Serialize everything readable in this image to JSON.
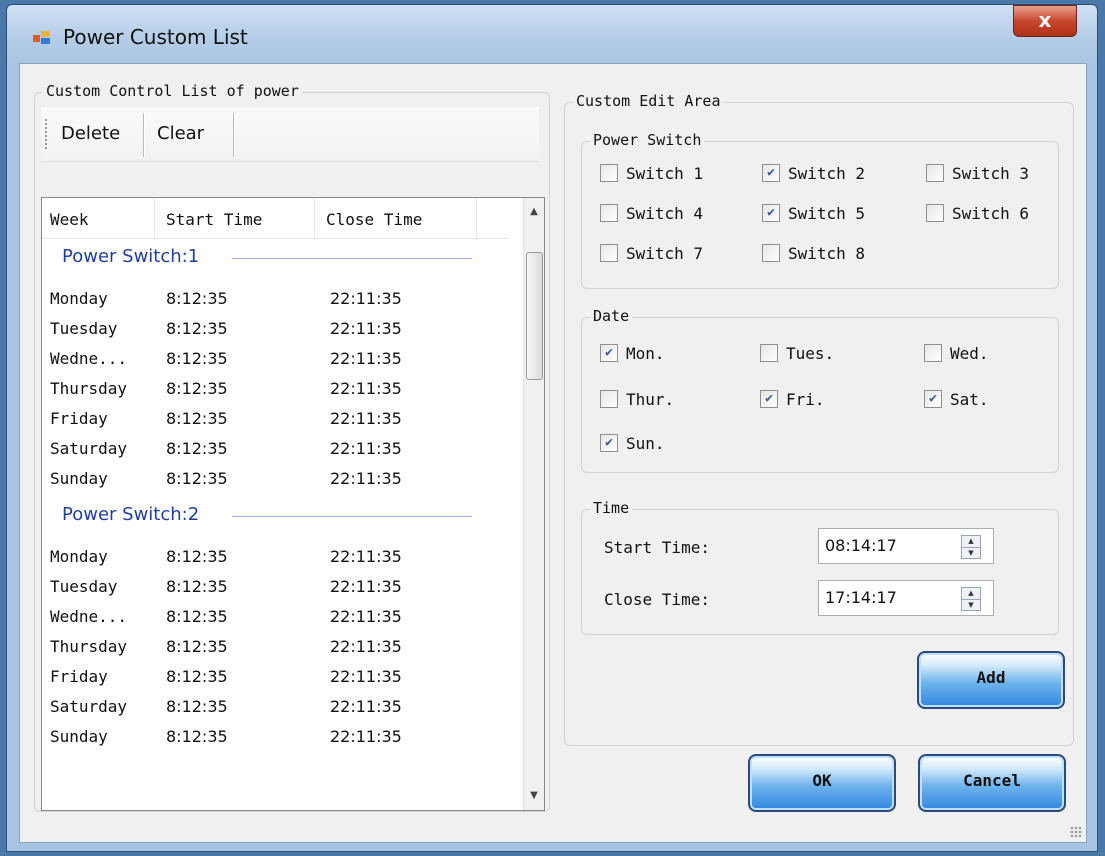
{
  "window": {
    "title": "Power Custom List",
    "close_glyph": "x"
  },
  "left_panel": {
    "legend": "Custom Control List of power",
    "toolbar": {
      "delete_label": "Delete",
      "clear_label": "Clear"
    },
    "columns": [
      "Week",
      "Start Time",
      "Close Time"
    ],
    "groups": [
      {
        "title": "Power Switch:1",
        "rows": [
          [
            "Monday",
            "8:12:35",
            "22:11:35"
          ],
          [
            "Tuesday",
            "8:12:35",
            "22:11:35"
          ],
          [
            "Wedne...",
            "8:12:35",
            "22:11:35"
          ],
          [
            "Thursday",
            "8:12:35",
            "22:11:35"
          ],
          [
            "Friday",
            "8:12:35",
            "22:11:35"
          ],
          [
            "Saturday",
            "8:12:35",
            "22:11:35"
          ],
          [
            "Sunday",
            "8:12:35",
            "22:11:35"
          ]
        ]
      },
      {
        "title": "Power Switch:2",
        "rows": [
          [
            "Monday",
            "8:12:35",
            "22:11:35"
          ],
          [
            "Tuesday",
            "8:12:35",
            "22:11:35"
          ],
          [
            "Wedne...",
            "8:12:35",
            "22:11:35"
          ],
          [
            "Thursday",
            "8:12:35",
            "22:11:35"
          ],
          [
            "Friday",
            "8:12:35",
            "22:11:35"
          ],
          [
            "Saturday",
            "8:12:35",
            "22:11:35"
          ],
          [
            "Sunday",
            "8:12:35",
            "22:11:35"
          ]
        ]
      }
    ]
  },
  "edit_area": {
    "legend": "Custom Edit Area",
    "power_switch": {
      "legend": "Power Switch",
      "items": [
        {
          "label": "Switch 1",
          "checked": false
        },
        {
          "label": "Switch 2",
          "checked": true
        },
        {
          "label": "Switch 3",
          "checked": false
        },
        {
          "label": "Switch 4",
          "checked": false
        },
        {
          "label": "Switch 5",
          "checked": true
        },
        {
          "label": "Switch 6",
          "checked": false
        },
        {
          "label": "Switch 7",
          "checked": false
        },
        {
          "label": "Switch 8",
          "checked": false
        }
      ]
    },
    "date": {
      "legend": "Date",
      "items": [
        {
          "label": "Mon.",
          "checked": true
        },
        {
          "label": "Tues.",
          "checked": false
        },
        {
          "label": "Wed.",
          "checked": false
        },
        {
          "label": "Thur.",
          "checked": false
        },
        {
          "label": "Fri.",
          "checked": true
        },
        {
          "label": "Sat.",
          "checked": true
        },
        {
          "label": "Sun.",
          "checked": true
        }
      ]
    },
    "time": {
      "legend": "Time",
      "start_label": "Start Time:",
      "start_value": "08:14:17",
      "close_label": "Close Time:",
      "close_value": "17:14:17"
    },
    "add_label": "Add"
  },
  "footer": {
    "ok_label": "OK",
    "cancel_label": "Cancel"
  },
  "colors": {
    "group_header": "#1e3f9f",
    "check_mark": "#3a5a98",
    "button_blue": "#2f86de"
  }
}
